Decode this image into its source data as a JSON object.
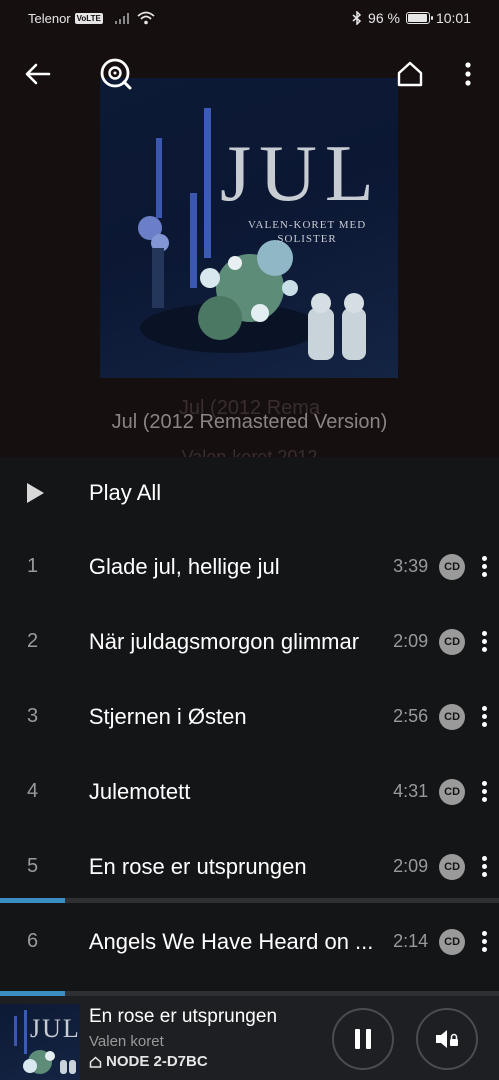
{
  "status": {
    "carrier": "Telenor",
    "volte": "VoLTE",
    "battery": "96 %",
    "battery_level": 0.96,
    "time": "10:01"
  },
  "nav": {
    "back_icon": "arrow-left-icon",
    "search_icon": "search-disc-icon",
    "home_icon": "home-icon",
    "more_icon": "more-vertical-icon"
  },
  "cover": {
    "title": "JUL",
    "subtitle_line1": "VALEN-KORET MED",
    "subtitle_line2": "SOLISTER"
  },
  "album": {
    "title_ghost": "Jul (2012 Rema",
    "title": "Jul (2012 Remastered Version)",
    "subtitle_ghost": "Valen-koret 2012"
  },
  "play_all_label": "Play All",
  "tracks": [
    {
      "num": "1",
      "title": "Glade jul, hellige jul",
      "duration": "3:39",
      "badge": "CD"
    },
    {
      "num": "2",
      "title": "När juldagsmorgon glimmar",
      "duration": "2:09",
      "badge": "CD"
    },
    {
      "num": "3",
      "title": "Stjernen i Østen",
      "duration": "2:56",
      "badge": "CD"
    },
    {
      "num": "4",
      "title": "Julemotett",
      "duration": "4:31",
      "badge": "CD"
    },
    {
      "num": "5",
      "title": "En rose er utsprungen",
      "duration": "2:09",
      "badge": "CD"
    },
    {
      "num": "6",
      "title": "Angels We Have Heard on ...",
      "duration": "2:14",
      "badge": "CD"
    }
  ],
  "now_playing": {
    "title": "En rose er utsprungen",
    "artist": "Valen koret",
    "node": "NODE 2-D7BC",
    "progress": 0.13,
    "cover_text": "JUL"
  },
  "colors": {
    "accent": "#3b8fc2",
    "background": "#141517",
    "header_bg": "#150f10"
  }
}
